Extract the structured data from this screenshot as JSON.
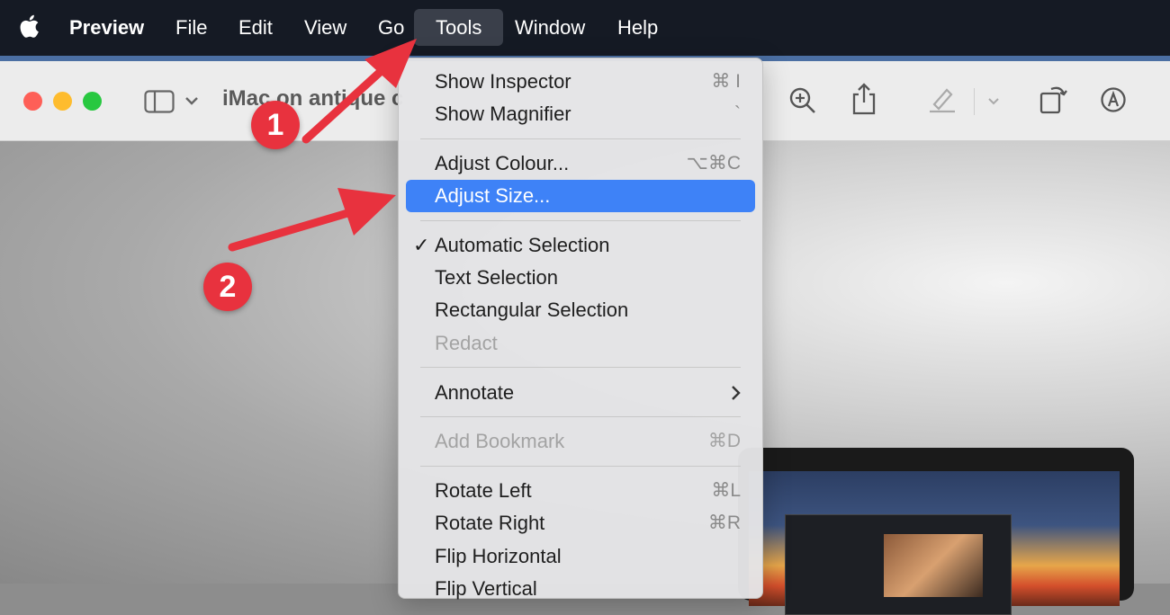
{
  "menubar": {
    "app_name": "Preview",
    "items": [
      "File",
      "Edit",
      "View",
      "Go",
      "Tools",
      "Window",
      "Help"
    ],
    "active_item": "Tools"
  },
  "window": {
    "doc_title": "iMac on antique c"
  },
  "tools_menu": {
    "items": [
      {
        "label": "Show Inspector",
        "shortcut": "⌘ I"
      },
      {
        "label": "Show Magnifier",
        "shortcut": "`"
      },
      {
        "label": "Adjust Colour...",
        "shortcut": "⌥⌘C"
      },
      {
        "label": "Adjust Size...",
        "shortcut": "",
        "highlighted": true
      },
      {
        "label": "Automatic Selection",
        "checked": true
      },
      {
        "label": "Text Selection"
      },
      {
        "label": "Rectangular Selection"
      },
      {
        "label": "Redact",
        "disabled": true
      },
      {
        "label": "Annotate",
        "submenu": true
      },
      {
        "label": "Add Bookmark",
        "shortcut": "⌘D",
        "disabled": true
      },
      {
        "label": "Rotate Left",
        "shortcut": "⌘L"
      },
      {
        "label": "Rotate Right",
        "shortcut": "⌘R"
      },
      {
        "label": "Flip Horizontal"
      },
      {
        "label": "Flip Vertical"
      }
    ]
  },
  "annotations": {
    "step1": "1",
    "step2": "2",
    "color": "#e8323e"
  },
  "icons": [
    "apple-icon",
    "sidebar-toggle-icon",
    "chevron-down-icon",
    "zoom-in-icon",
    "share-icon",
    "highlight-pen-icon",
    "rotate-icon",
    "markup-icon"
  ]
}
